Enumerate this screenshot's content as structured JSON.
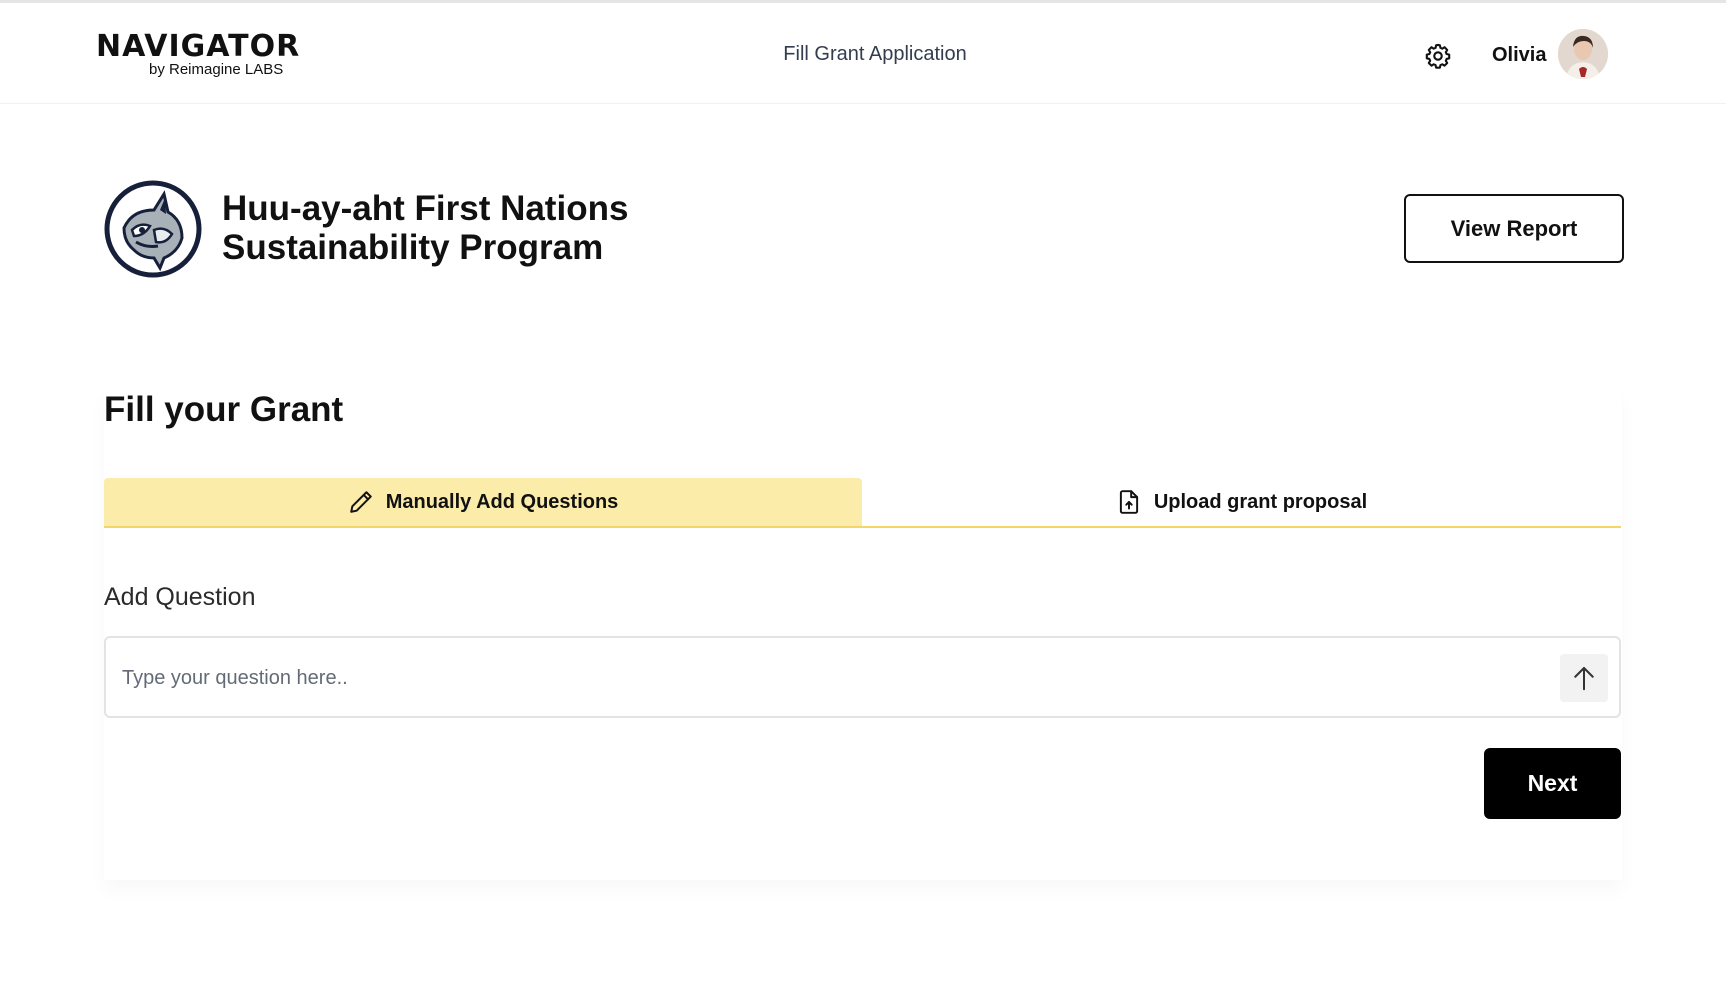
{
  "header": {
    "logo_word": "NAVIGATOR",
    "logo_sub": "by Reimagine LABS",
    "page_title": "Fill Grant Application",
    "settings_icon": "gear-icon",
    "user_name": "Olivia",
    "avatar_icon": "user-avatar"
  },
  "organization": {
    "name": "Huu-ay-aht First Nations\nSustainability Program",
    "logo_icon": "orca-emblem-icon",
    "view_report_label": "View Report"
  },
  "form": {
    "title": "Fill your Grant",
    "tabs": [
      {
        "label": "Manually Add Questions",
        "icon": "pencil-icon",
        "active": true
      },
      {
        "label": "Upload grant proposal",
        "icon": "file-upload-icon",
        "active": false
      }
    ],
    "add_question_label": "Add Question",
    "question_placeholder": "Type your question here..",
    "question_value": "",
    "send_icon": "arrow-up-icon",
    "next_label": "Next"
  },
  "colors": {
    "active_tab": "#fcecaa",
    "tab_underline": "#f2d66a",
    "primary_button": "#000000"
  }
}
